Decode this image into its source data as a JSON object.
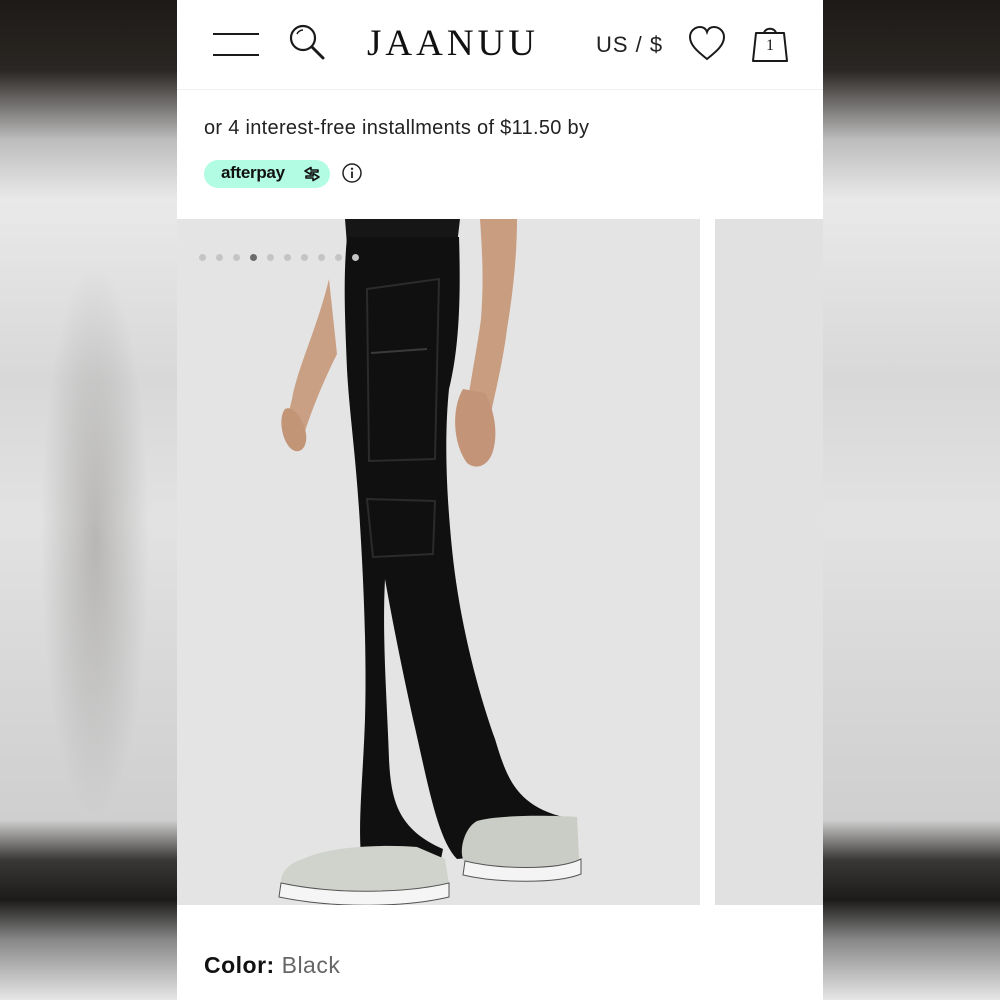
{
  "header": {
    "logo": "JAANUU",
    "currency": "US / $",
    "bag_count": "1",
    "icons": [
      "menu-icon",
      "search-icon",
      "heart-icon",
      "shopping-bag-icon"
    ]
  },
  "payment": {
    "installments_text": "or 4 interest-free installments of $11.50 by",
    "afterpay_label": "afterpay",
    "afterpay_color": "#b2fce4",
    "info_icon": "info-circle-icon"
  },
  "gallery": {
    "image_description_icon": "product-photo",
    "dots_count": 10,
    "active_dot": 3
  },
  "product": {
    "color_label": "Color:",
    "color_value": "Black"
  }
}
